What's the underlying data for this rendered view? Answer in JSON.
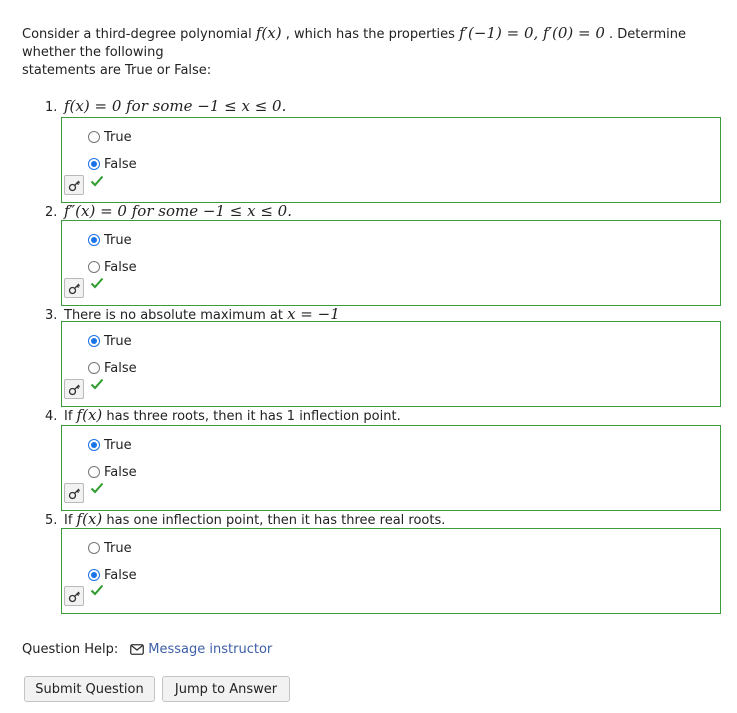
{
  "intro": {
    "text_before": "Consider a third-degree polynomial",
    "func": "f(x)",
    "text_middle": ", which has the properties",
    "props": "f′(−1) = 0, f′(0) = 0",
    "text_after": ". Determine whether the following",
    "line3": "statements are True or False:"
  },
  "questions": [
    {
      "number": "1.",
      "math1": "f(x)",
      "text1": " = 0 for some ",
      "math2": "−1 ≤ x ≤ 0.",
      "text2": "",
      "options": [
        {
          "label": "True",
          "selected": false
        },
        {
          "label": "False",
          "selected": true
        }
      ]
    },
    {
      "number": "2.",
      "math1": "f″(x)",
      "text1": " = 0 for some ",
      "math2": "−1 ≤ x ≤ 0.",
      "text2": "",
      "options": [
        {
          "label": "True",
          "selected": true
        },
        {
          "label": "False",
          "selected": false
        }
      ]
    },
    {
      "number": "3.",
      "math1": "",
      "text1": "There is no absolute maximum at ",
      "math2": "x = −1",
      "text2": "",
      "options": [
        {
          "label": "True",
          "selected": true
        },
        {
          "label": "False",
          "selected": false
        }
      ]
    },
    {
      "number": "4.",
      "math1": "",
      "text1": "If ",
      "math2": "f(x)",
      "text2": " has three roots, then it has 1 inflection point.",
      "options": [
        {
          "label": "True",
          "selected": true
        },
        {
          "label": "False",
          "selected": false
        }
      ]
    },
    {
      "number": "5.",
      "math1": "",
      "text1": "If ",
      "math2": "f(x)",
      "text2": " has one inflection point, then it has three real roots.",
      "options": [
        {
          "label": "True",
          "selected": false
        },
        {
          "label": "False",
          "selected": true
        }
      ]
    }
  ],
  "help": {
    "label": "Question Help:",
    "link": "Message instructor"
  },
  "buttons": {
    "submit": "Submit Question",
    "jump": "Jump to Answer"
  },
  "colors": {
    "box_border": "#3c9b3c",
    "radio_selected": "#1a73e8",
    "check": "#2e9b2e",
    "link": "#3d5fa8"
  }
}
